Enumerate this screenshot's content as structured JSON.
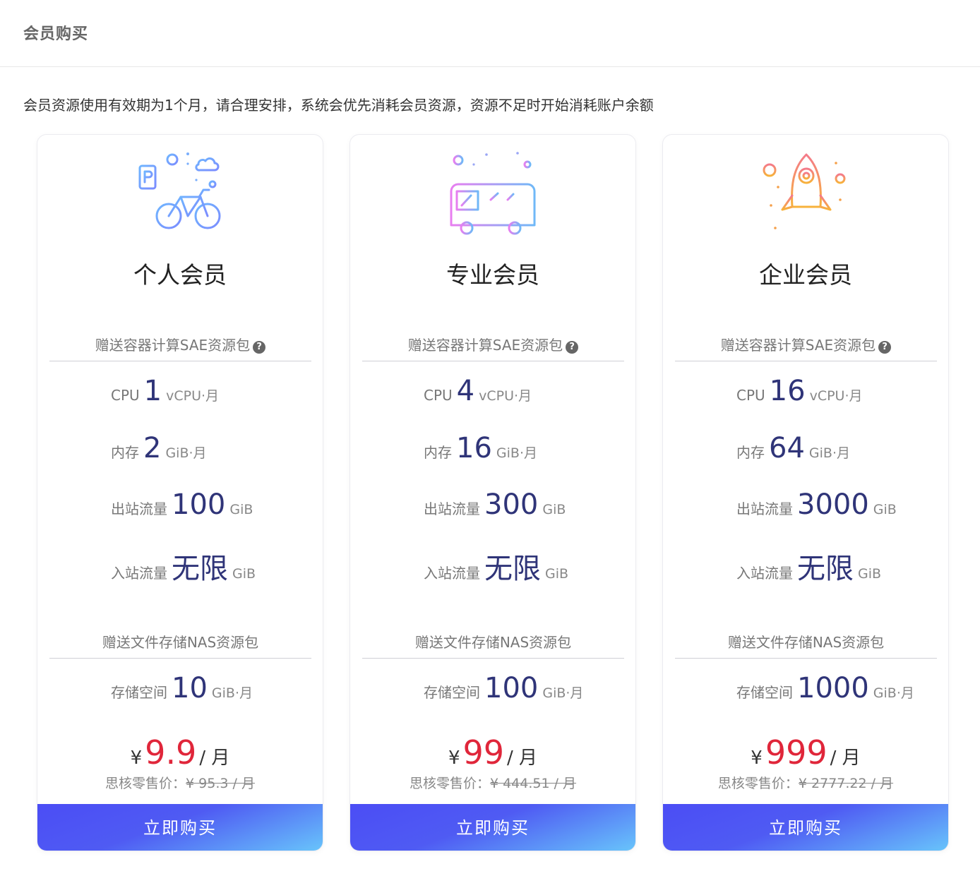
{
  "header": {
    "title": "会员购买"
  },
  "notice": "会员资源使用有效期为1个月，请合理安排，系统会优先消耗会员资源，资源不足时开始消耗账户余额",
  "plans": [
    {
      "name": "个人会员",
      "icon": "bicycle-parking-icon",
      "sae_title": "赠送容器计算SAE资源包",
      "help_glyph": "?",
      "specs": [
        {
          "label": "CPU",
          "value": "1",
          "unit": "vCPU·月"
        },
        {
          "label": "内存",
          "value": "2",
          "unit": "GiB·月"
        },
        {
          "label": "出站流量",
          "value": "100",
          "unit": "GiB"
        },
        {
          "label": "入站流量",
          "value": "无限",
          "unit": "GiB"
        }
      ],
      "nas_title": "赠送文件存储NAS资源包",
      "storage": {
        "label": "存储空间",
        "value": "10",
        "unit": "GiB·月"
      },
      "price": {
        "currency": "¥",
        "amount": "9.9",
        "per": "/ 月"
      },
      "original": {
        "label": "思核零售价：",
        "value": "¥ 95.3 / 月"
      },
      "buy_label": "立即购买"
    },
    {
      "name": "专业会员",
      "icon": "bus-icon",
      "sae_title": "赠送容器计算SAE资源包",
      "help_glyph": "?",
      "specs": [
        {
          "label": "CPU",
          "value": "4",
          "unit": "vCPU·月"
        },
        {
          "label": "内存",
          "value": "16",
          "unit": "GiB·月"
        },
        {
          "label": "出站流量",
          "value": "300",
          "unit": "GiB"
        },
        {
          "label": "入站流量",
          "value": "无限",
          "unit": "GiB"
        }
      ],
      "nas_title": "赠送文件存储NAS资源包",
      "storage": {
        "label": "存储空间",
        "value": "100",
        "unit": "GiB·月"
      },
      "price": {
        "currency": "¥",
        "amount": "99",
        "per": "/ 月"
      },
      "original": {
        "label": "思核零售价：",
        "value": "¥ 444.51 / 月"
      },
      "buy_label": "立即购买"
    },
    {
      "name": "企业会员",
      "icon": "rocket-icon",
      "sae_title": "赠送容器计算SAE资源包",
      "help_glyph": "?",
      "specs": [
        {
          "label": "CPU",
          "value": "16",
          "unit": "vCPU·月"
        },
        {
          "label": "内存",
          "value": "64",
          "unit": "GiB·月"
        },
        {
          "label": "出站流量",
          "value": "3000",
          "unit": "GiB"
        },
        {
          "label": "入站流量",
          "value": "无限",
          "unit": "GiB"
        }
      ],
      "nas_title": "赠送文件存储NAS资源包",
      "storage": {
        "label": "存储空间",
        "value": "1000",
        "unit": "GiB·月"
      },
      "price": {
        "currency": "¥",
        "amount": "999",
        "per": "/ 月"
      },
      "original": {
        "label": "思核零售价：",
        "value": "¥ 2777.22 / 月"
      },
      "buy_label": "立即购买"
    }
  ],
  "colors": {
    "accent_value": "#2f3478",
    "price_red": "#e0263a",
    "button_gradient_start": "#4b4df5",
    "button_gradient_end": "#68c4fb"
  }
}
